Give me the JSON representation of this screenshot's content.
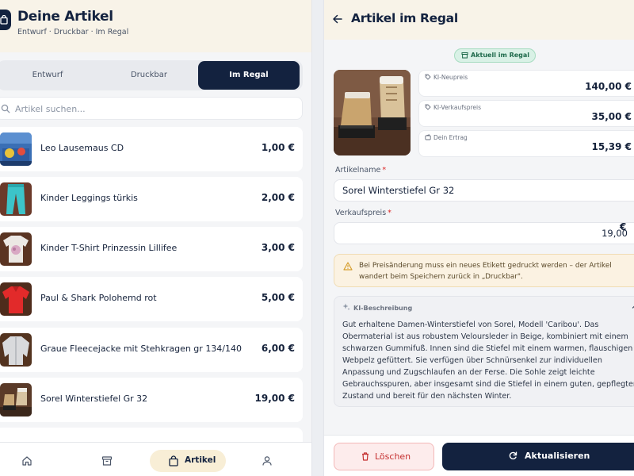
{
  "left": {
    "title": "Deine Artikel",
    "subtitle": "Entwurf · Druckbar · Im Regal",
    "tabs": [
      {
        "label": "Entwurf"
      },
      {
        "label": "Druckbar"
      },
      {
        "label": "Im Regal",
        "active": true
      }
    ],
    "search_placeholder": "Artikel suchen...",
    "items": [
      {
        "name": "Leo Lausemaus CD",
        "price": "1,00 €"
      },
      {
        "name": "Kinder Leggings türkis",
        "price": "2,00 €"
      },
      {
        "name": "Kinder T-Shirt Prinzessin Lillifee",
        "price": "3,00 €"
      },
      {
        "name": "Paul & Shark Polohemd rot",
        "price": "5,00 €"
      },
      {
        "name": "Graue Fleecejacke mit Stehkragen gr 134/140",
        "price": "6,00 €"
      },
      {
        "name": "Sorel Winterstiefel Gr 32",
        "price": "19,00 €"
      }
    ],
    "nav": [
      {
        "icon": "home-icon"
      },
      {
        "icon": "archive-box-icon"
      },
      {
        "icon": "shopping-bag-icon",
        "label": "Artikel",
        "active": true
      },
      {
        "icon": "user-icon"
      }
    ]
  },
  "right": {
    "title": "Artikel im Regal",
    "status_badge": "Aktuell im Regal",
    "prices": {
      "ki_neupreis_label": "KI-Neupreis",
      "ki_neupreis_value": "140,00 €",
      "ki_verkaufspreis_label": "KI-Verkaufspreis",
      "ki_verkaufspreis_value": "35,00 €",
      "ertrag_label": "Dein Ertrag",
      "ertrag_value": "15,39 €"
    },
    "name_label": "Artikelname",
    "name_value": "Sorel Winterstiefel Gr 32",
    "price_label": "Verkaufspreis",
    "price_value": "19,00",
    "currency": "€",
    "required_mark": "*",
    "warning": "Bei Preisänderung muss ein neues Etikett gedruckt werden – der Artikel wandert beim Speichern zurück in „Druckbar\".",
    "description_label": "KI-Beschreibung",
    "description": "Gut erhaltene Damen-Winterstiefel von Sorel, Modell 'Caribou'. Das Obermaterial ist aus robustem Veloursleder in Beige, kombiniert mit einem schwarzen Gummifuß. Innen sind die Stiefel mit einem warmen, flauschigen Webpelz gefüttert. Sie verfügen über Schnürsenkel zur individuellen Anpassung und Zugschlaufen an der Ferse. Die Sohle zeigt leichte Gebrauchsspuren, aber insgesamt sind die Stiefel in einem guten, gepflegten Zustand und bereit für den nächsten Winter.",
    "delete_label": "Löschen",
    "update_label": "Aktualisieren"
  },
  "colors": {
    "navy": "#13223f",
    "header_cream": "#f8f3e8",
    "badge_green": "#d9f1e6",
    "delete_red": "#c53030",
    "warning_bg": "#fbf2e2"
  }
}
